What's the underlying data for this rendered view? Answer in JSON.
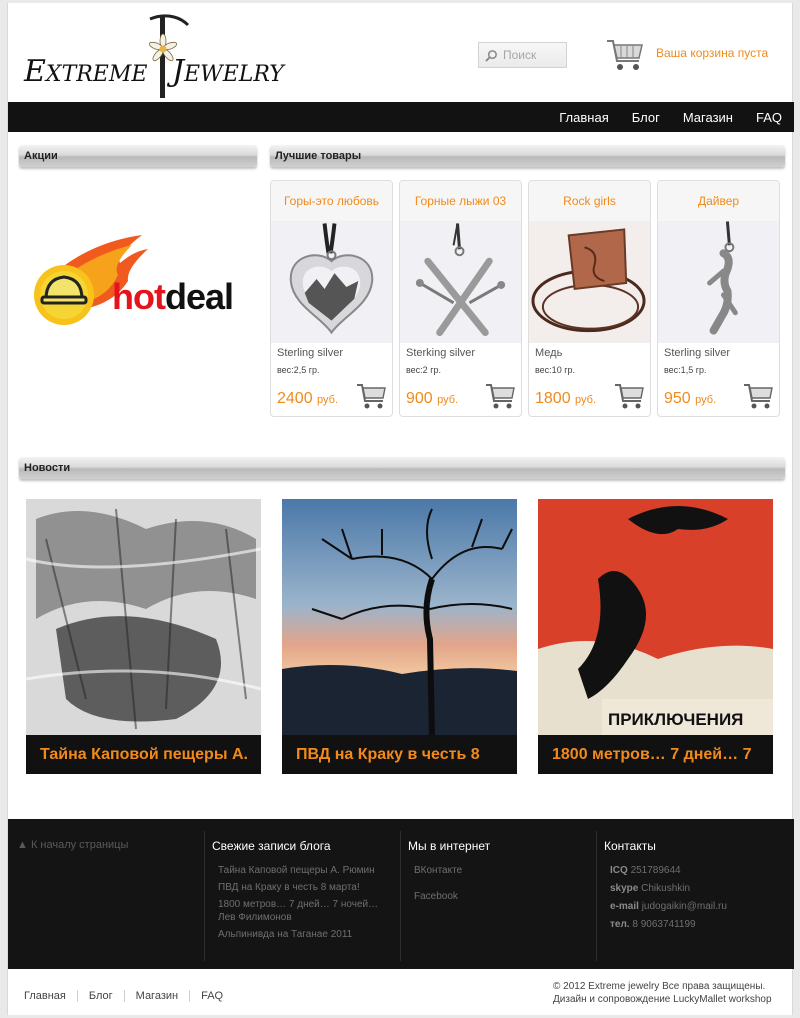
{
  "header": {
    "logo_text": "ExtremeJewelry",
    "search": {
      "placeholder": "Поиск"
    },
    "cart_status": "Ваша корзина пуста"
  },
  "nav": {
    "items": [
      "Главная",
      "Блог",
      "Магазин",
      "FAQ"
    ]
  },
  "sections": {
    "promo_title": "Акции",
    "best_title": "Лучшие товары",
    "news_title": "Новости"
  },
  "promo": {
    "banner_text": "hotdeal"
  },
  "products": [
    {
      "title": "Горы-это любовь",
      "material": "Sterling silver",
      "weight": "вес:2,5 гр.",
      "price": "2400",
      "currency": "руб."
    },
    {
      "title": "Горные лыжи 03",
      "material": "Sterking silver",
      "weight": "вес:2 гр.",
      "price": "900",
      "currency": "руб."
    },
    {
      "title": "Rock girls",
      "material": "Медь",
      "weight": "вес:10 гр.",
      "price": "1800",
      "currency": "руб."
    },
    {
      "title": "Дайвер",
      "material": "Sterling silver",
      "weight": "вес:1,5 гр.",
      "price": "950",
      "currency": "руб."
    }
  ],
  "news": [
    {
      "caption": "Тайна Каповой пещеры А."
    },
    {
      "caption": "ПВД на Краку в честь 8"
    },
    {
      "caption": "1800 метров… 7 дней… 7"
    }
  ],
  "news_poster_text": "ПРИКЛЮЧЕНИЯ",
  "footer": {
    "back_to_top": "▲ К началу страницы",
    "blog": {
      "title": "Свежие записи блога",
      "items": [
        "Тайна Каповой пещеры А. Рюмин",
        "ПВД на Краку в честь 8 марта!",
        "1800 метров… 7 дней… 7 ночей… Лев Филимонов",
        "Альпинивда на Таганае 2011"
      ]
    },
    "social": {
      "title": "Мы в интернет",
      "items": [
        "ВКонтакте",
        "Facebook"
      ]
    },
    "contacts": {
      "title": "Контакты",
      "icq_label": "ICQ",
      "icq": "251789644",
      "skype_label": "skype",
      "skype": "Chikushkin",
      "email_label": "e-mail",
      "email": "judogaikin@mail.ru",
      "phone_label": "тел.",
      "phone": "8 9063741199"
    }
  },
  "bottom": {
    "nav": [
      "Главная",
      "Блог",
      "Магазин",
      "FAQ"
    ],
    "copyright": "© 2012 Extreme jewelry Все права защищены.",
    "credits": "Дизайн и сопровождение LuckyMallet workshop"
  },
  "colors": {
    "accent": "#f18a1b",
    "navbar": "#121212",
    "footer": "#141414"
  }
}
